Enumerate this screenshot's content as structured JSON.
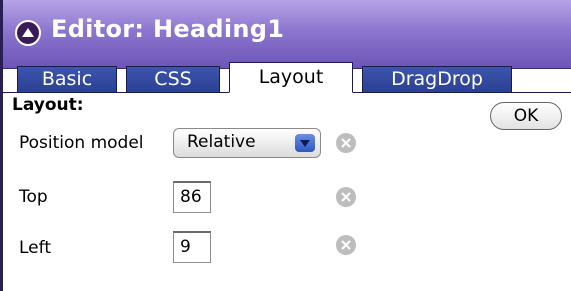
{
  "window": {
    "title": "Editor: Heading1"
  },
  "tabs": [
    {
      "label": "Basic",
      "active": false
    },
    {
      "label": "CSS",
      "active": false
    },
    {
      "label": "Layout",
      "active": true
    },
    {
      "label": "DragDrop",
      "active": false
    }
  ],
  "panel": {
    "section_label": "Layout:",
    "ok_label": "OK",
    "position_model": {
      "label": "Position model",
      "selected": "Relative"
    },
    "top": {
      "label": "Top",
      "value": "86"
    },
    "left": {
      "label": "Left",
      "value": "9"
    }
  },
  "colors": {
    "title_bar": "#8c76cf",
    "tab_inactive": "#2f4499",
    "accent_dark": "#2a1f52"
  },
  "icons": {
    "collapse": "chevron-up-icon",
    "dropdown": "chevron-down-icon",
    "clear": "close-circle-icon"
  }
}
